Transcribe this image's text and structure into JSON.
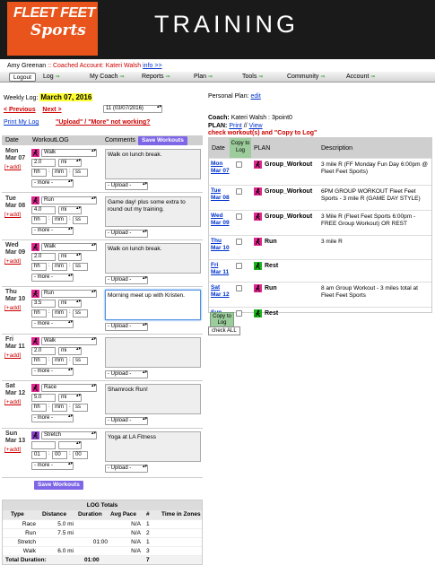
{
  "brand": {
    "line1": "FLEET FEET",
    "line2": "Sports",
    "title": "TRAINING"
  },
  "account": {
    "user": "Amy Greenan",
    "sep": "::",
    "coached_label": "Coached Account: Kateri Walsh",
    "info": "info >>"
  },
  "nav": {
    "logout": "Logout",
    "items": [
      "Log",
      "My Coach",
      "Reports",
      "Plan",
      "Tools",
      "Community",
      "Account"
    ],
    "arrow": "⇒"
  },
  "log": {
    "weekly_label": "Weekly Log:",
    "weekly_date": "March 07, 2016",
    "prev": "< Previous",
    "next": "Next >",
    "week_select": "11 (03/07/2016)",
    "print": "Print My Log",
    "upload_help": "\"Upload\" / \"More\" not working?",
    "headers": {
      "date": "Date",
      "workout": "WorkoutLOG",
      "comments": "Comments",
      "save": "Save Workouts"
    },
    "add_label": "[+add]",
    "more_label": "- more -",
    "upload_label": "- Upload -",
    "days": [
      {
        "dow": "Mon",
        "date": "Mar 07",
        "type": "Walk",
        "dist": "2.0",
        "unit": "mi",
        "h": "hh",
        "m": "mm",
        "s": "ss",
        "comment": "Walk on lunch break.",
        "icon_color": "#e0268f"
      },
      {
        "dow": "Tue",
        "date": "Mar 08",
        "type": "Run",
        "dist": "4.0",
        "unit": "mi",
        "h": "hh",
        "m": "mm",
        "s": "ss",
        "comment": "Game day! plus some extra to round out my training.",
        "icon_color": "#e0268f"
      },
      {
        "dow": "Wed",
        "date": "Mar 09",
        "type": "Walk",
        "dist": "2.0",
        "unit": "mi",
        "h": "hh",
        "m": "mm",
        "s": "ss",
        "comment": "Walk on lunch break.",
        "icon_color": "#e0268f"
      },
      {
        "dow": "Thu",
        "date": "Mar 10",
        "type": "Run",
        "dist": "3.5",
        "unit": "mi",
        "h": "hh",
        "m": "mm",
        "s": "ss",
        "comment": "Morning meet up with Kristen.",
        "icon_color": "#e0268f"
      },
      {
        "dow": "Fri",
        "date": "Mar 11",
        "type": "Walk",
        "dist": "2.0",
        "unit": "mi",
        "h": "hh",
        "m": "mm",
        "s": "ss",
        "comment": "",
        "icon_color": "#e0268f"
      },
      {
        "dow": "Sat",
        "date": "Mar 12",
        "type": "Race",
        "dist": "5.0",
        "unit": "mi",
        "h": "hh",
        "m": "mm",
        "s": "ss",
        "comment": "Shamrock Run!",
        "icon_color": "#e0268f"
      },
      {
        "dow": "Sun",
        "date": "Mar 13",
        "type": "Stretch",
        "dist": "",
        "unit": "",
        "h": "01",
        "m": "00",
        "s": "00",
        "comment": "Yoga at LA Fitness",
        "icon_color": "#8a3fc8"
      }
    ]
  },
  "totals": {
    "title": "LOG Totals",
    "headers": [
      "Type",
      "Distance",
      "Duration",
      "Avg Pace",
      "#",
      "Time in Zones"
    ],
    "rows": [
      {
        "type": "Race",
        "distance": "5.0 mi",
        "duration": "",
        "pace": "N/A",
        "count": "1"
      },
      {
        "type": "Run",
        "distance": "7.5 mi",
        "duration": "",
        "pace": "N/A",
        "count": "2"
      },
      {
        "type": "Stretch",
        "distance": "",
        "duration": "01:00",
        "pace": "N/A",
        "count": "1"
      },
      {
        "type": "Walk",
        "distance": "6.0 mi",
        "duration": "",
        "pace": "N/A",
        "count": "3"
      }
    ],
    "total_label": "Total Duration:",
    "total_duration": "01:00",
    "total_count": "7"
  },
  "plan": {
    "personal_label": "Personal Plan:",
    "edit": "edit",
    "coach_label": "Coach:",
    "coach_value": "Kateri Walsh : 3point0",
    "plan_label": "PLAN:",
    "print": "Print",
    "sep": "//",
    "view": "View",
    "check_msg": "check workout(s) and \"Copy to Log\"",
    "headers": {
      "date": "Date",
      "copy": "Copy to Log",
      "plan": "PLAN",
      "desc": "Description"
    },
    "rows": [
      {
        "dow": "Mon",
        "date": "Mar 07",
        "name": "Group_Workout",
        "desc": "3 mile R (FF Monday Fun Day 6:00pm @ Fleet Feet Sports)",
        "icon_color": "#e0268f"
      },
      {
        "dow": "Tue",
        "date": "Mar 08",
        "name": "Group_Workout",
        "desc": "6PM GROUP WORKOUT Fleet Feet Sports - 3 mile R (GAME DAY STYLE)",
        "icon_color": "#e0268f"
      },
      {
        "dow": "Wed",
        "date": "Mar 09",
        "name": "Group_Workout",
        "desc": "3 Mile R (Fleet Feet Sports 6:00pm - FREE Group Workout) OR REST",
        "icon_color": "#e0268f"
      },
      {
        "dow": "Thu",
        "date": "Mar 10",
        "name": "Run",
        "desc": "3 mile R",
        "icon_color": "#e0268f"
      },
      {
        "dow": "Fri",
        "date": "Mar 11",
        "name": "Rest",
        "desc": "",
        "icon_color": "#1bb31b"
      },
      {
        "dow": "Sat",
        "date": "Mar 12",
        "name": "Run",
        "desc": "8 am Group Workout - 3 miles total at Fleet Feet Sports",
        "icon_color": "#e0268f"
      },
      {
        "dow": "Sun",
        "date": "Mar 13",
        "name": "Rest",
        "desc": "",
        "icon_color": "#1bb31b"
      }
    ],
    "copy_button": "Copy to Log",
    "check_all": "check ALL"
  }
}
